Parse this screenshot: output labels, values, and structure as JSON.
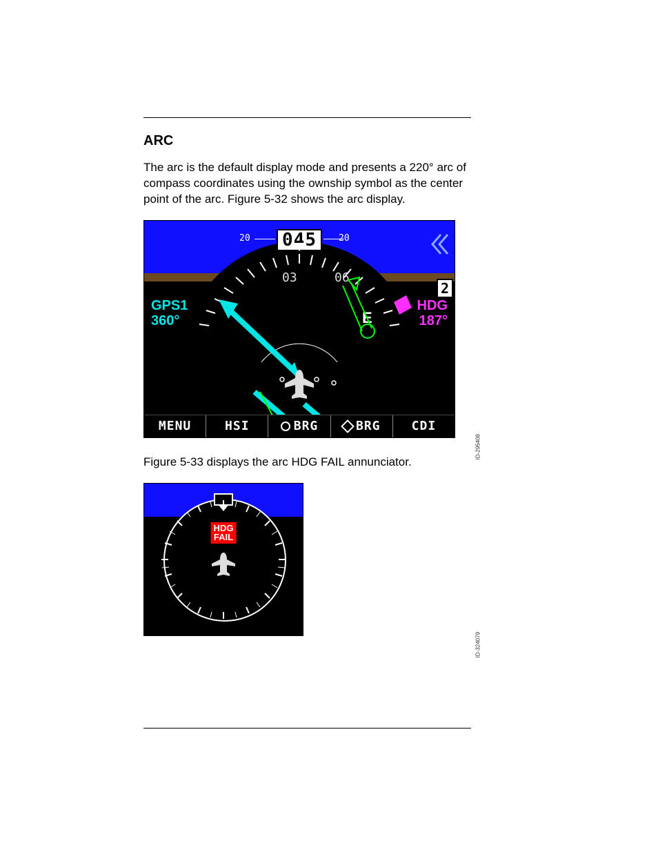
{
  "section_title": "ARC",
  "para1": "The arc is the default display mode and presents a 220° arc of compass coordinates using the ownship symbol as the center point of the arc. Figure 5-32 shows the arc display.",
  "para2": "Figure 5-33 displays the arc HDG FAIL annunciator.",
  "fig1": {
    "heading_box": "045",
    "tape_left": "20",
    "tape_right": "20",
    "scale_03": "03",
    "scale_06": "06",
    "E_label": "E",
    "right_num2": "2",
    "gps_src": "GPS1",
    "gps_val": "360°",
    "hdg_label": "HDG",
    "hdg_val": "187°",
    "menu": {
      "b1": "MENU",
      "b2": "HSI",
      "b3": "BRG",
      "b4": "BRG",
      "b5": "CDI"
    },
    "img_id": "ID-295408"
  },
  "fig2": {
    "fail_line1": "HDG",
    "fail_line2": "FAIL",
    "img_id": "ID-324079"
  }
}
